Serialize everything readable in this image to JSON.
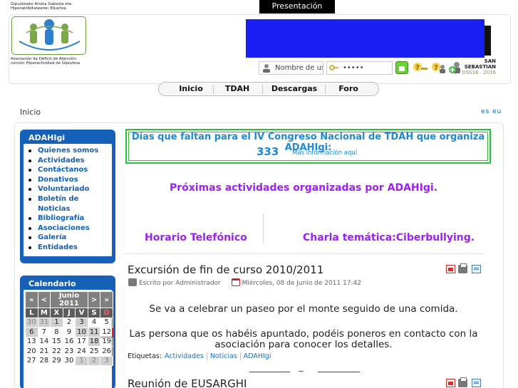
{
  "top_tab": {
    "label": "Presentación"
  },
  "logo": {
    "line1": "Gipuzkoako Arreta Gabezia eta",
    "line2": "Hiperaktibitatearen Elkartea",
    "line3": "Asociación de Déficit de Atención",
    "line4": "con/sin Hiperactividad de Gipuzkoa"
  },
  "banner": {
    "badge_line1": "SAN SEBASTIAN",
    "badge_line2": "DSS16 · 2016"
  },
  "login": {
    "user_placeholder": "Nombre de usu",
    "password_mask": "•••••"
  },
  "nav": {
    "items": [
      "Inicio",
      "TDAH",
      "Descargas",
      "Foro"
    ]
  },
  "breadcrumb": "Inicio",
  "languages": [
    "es",
    "eu"
  ],
  "sidebar": {
    "menu_title": "ADAHIgi",
    "menu_items": [
      "Quienes somos",
      "Actividades",
      "Contáctanos",
      "Donativos",
      "Voluntariado",
      "Boletín de Noticias",
      "Bibliografía",
      "Asociaciones",
      "Galería",
      "Entidades"
    ],
    "calendar_title": "Calendario",
    "calendar": {
      "prev_year": "«",
      "prev_month": "<",
      "month_label": "Junio 2011",
      "next_month": ">",
      "next_year": "»",
      "weekdays": [
        "L",
        "M",
        "X",
        "J",
        "V",
        "S",
        "D"
      ],
      "weeks": [
        [
          "30",
          "31",
          "1",
          "2",
          "3",
          "4",
          "5"
        ],
        [
          "6",
          "7",
          "8",
          "9",
          "10",
          "11",
          "12"
        ],
        [
          "13",
          "14",
          "15",
          "16",
          "17",
          "18",
          "19"
        ],
        [
          "20",
          "21",
          "22",
          "23",
          "24",
          "25",
          "26"
        ],
        [
          "27",
          "28",
          "29",
          "30",
          "1",
          "2",
          "3"
        ]
      ]
    }
  },
  "countdown": {
    "title": "Días que faltan para el IV Congreso Nacional de TDAH que organiza ADAHIgi:",
    "days": "333",
    "link": "Más información aquí"
  },
  "activities": {
    "title": "Próximas actividades organizadas por ADAHIgi.",
    "left": "Horario Telefónico",
    "right": "Charla temática:Ciberbullying."
  },
  "article1": {
    "title": "Excursión de fin de curso 2010/2011",
    "author": "Escrito por Administrador",
    "date": "Miércoles, 08 de Junio de 2011 17:42",
    "para1": "Se va a celebrar un paseo por el monte seguido de una comida.",
    "para2": "Las persona que os habéis apuntado, podéis poneros en contacto con la asociación para conocer los detalles.",
    "tags_label": "Etiquetas:",
    "tags": [
      "Actividades",
      "Noticias",
      "ADAHIgi"
    ]
  },
  "article2": {
    "title": "Reunión de EUSARGHI"
  }
}
